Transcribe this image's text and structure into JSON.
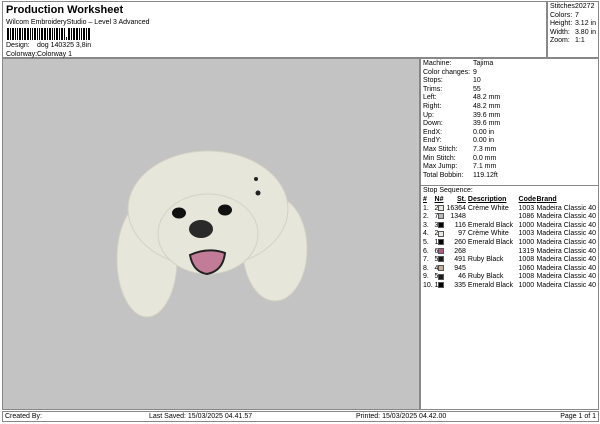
{
  "header": {
    "title": "Production Worksheet",
    "subtitle": "Wilcom EmbroideryStudio – Level 3 Advanced",
    "design_label": "Design:",
    "design_value": "dog 140325 3,8in",
    "colorway_label": "Colorway:",
    "colorway_value": "Colorway 1"
  },
  "stats": [
    {
      "k": "Stitches:",
      "v": "20272"
    },
    {
      "k": "Colors:",
      "v": "7"
    },
    {
      "k": "Height:",
      "v": "3.12 in"
    },
    {
      "k": "Width:",
      "v": "3.80 in"
    },
    {
      "k": "Zoom:",
      "v": "1:1"
    }
  ],
  "info": [
    {
      "k": "Machine:",
      "v": "Tajima"
    },
    {
      "k": "Color changes:",
      "v": "9"
    },
    {
      "k": "Stops:",
      "v": "10"
    },
    {
      "k": "Trims:",
      "v": "55"
    },
    {
      "k": "Left:",
      "v": "48.2 mm"
    },
    {
      "k": "Right:",
      "v": "48.2 mm"
    },
    {
      "k": "Up:",
      "v": "39.6 mm"
    },
    {
      "k": "Down:",
      "v": "39.6 mm"
    },
    {
      "k": "EndX:",
      "v": "0.00 in"
    },
    {
      "k": "EndY:",
      "v": "0.00 in"
    },
    {
      "k": "Max Stitch:",
      "v": "7.3 mm"
    },
    {
      "k": "Min Stitch:",
      "v": "0.0 mm"
    },
    {
      "k": "Max Jump:",
      "v": "7.1 mm"
    },
    {
      "k": "Total Bobbin:",
      "v": "119.12ft"
    }
  ],
  "sequence": {
    "title": "Stop Sequence:",
    "headers": [
      "#",
      "N#",
      "St.",
      "Description",
      "Code",
      "Brand"
    ],
    "rows": [
      {
        "n": "1.",
        "c": "2",
        "color": "#e8e8e0",
        "st": "16364",
        "desc": "Crème White",
        "code": "1003",
        "brand": "Madeira Classic 40"
      },
      {
        "n": "2.",
        "c": "7",
        "color": "#b8b8b8",
        "st": "1348",
        "desc": "",
        "code": "1086",
        "brand": "Madeira Classic 40"
      },
      {
        "n": "3.",
        "c": "3",
        "color": "#000000",
        "st": "116",
        "desc": "Emerald Black",
        "code": "1000",
        "brand": "Madeira Classic 40"
      },
      {
        "n": "4.",
        "c": "2",
        "color": "#e8e8e0",
        "st": "97",
        "desc": "Crème White",
        "code": "1003",
        "brand": "Madeira Classic 40"
      },
      {
        "n": "5.",
        "c": "1",
        "color": "#000000",
        "st": "260",
        "desc": "Emerald Black",
        "code": "1000",
        "brand": "Madeira Classic 40"
      },
      {
        "n": "6.",
        "c": "6",
        "color": "#b05a88",
        "st": "268",
        "desc": "",
        "code": "1319",
        "brand": "Madeira Classic 40"
      },
      {
        "n": "7.",
        "c": "5",
        "color": "#1a1a1a",
        "st": "491",
        "desc": "Ruby Black",
        "code": "1008",
        "brand": "Madeira Classic 40"
      },
      {
        "n": "8.",
        "c": "4",
        "color": "#bfb0a0",
        "st": "945",
        "desc": "",
        "code": "1060",
        "brand": "Madeira Classic 40"
      },
      {
        "n": "9.",
        "c": "5",
        "color": "#1a1a1a",
        "st": "46",
        "desc": "Ruby Black",
        "code": "1008",
        "brand": "Madeira Classic 40"
      },
      {
        "n": "10.",
        "c": "1",
        "color": "#000000",
        "st": "335",
        "desc": "Emerald Black",
        "code": "1000",
        "brand": "Madeira Classic 40"
      }
    ]
  },
  "footer": {
    "created": "Created By:",
    "saved": "Last Saved: 15/03/2025 04.41.57",
    "printed": "Printed: 15/03/2025 04.42.00",
    "page": "Page 1 of 1"
  }
}
